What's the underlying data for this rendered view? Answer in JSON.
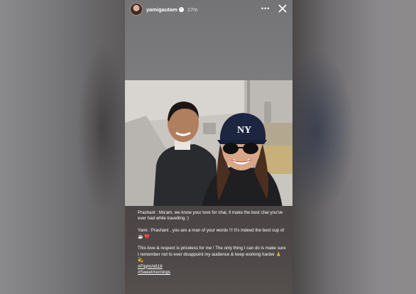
{
  "story": {
    "username": "yamigautam",
    "verified_mark": "✓",
    "time_ago": "17m",
    "more_label": "•••",
    "caption": {
      "para1": "Prashant : Ma'am, we know your love for chai, Il make the best chai you've ever had while travelling :)",
      "para2": "Yami : Prashant , you are a man of your words !!! It's indeed the best cup of ☕ ❤️",
      "para3": "This love & respect is priceless for me ! The only thing I can do is make sure I remember not to ever disappoint my audience & keep working harder 🙏💫",
      "hashtags": [
        "#FlightAI618",
        "#Sweetmornings"
      ]
    }
  },
  "colors": {
    "caption_bg": "#4a4544",
    "text": "#ffffff"
  },
  "icons": [
    "avatar",
    "verified-badge-icon",
    "more-options-icon",
    "close-icon"
  ]
}
